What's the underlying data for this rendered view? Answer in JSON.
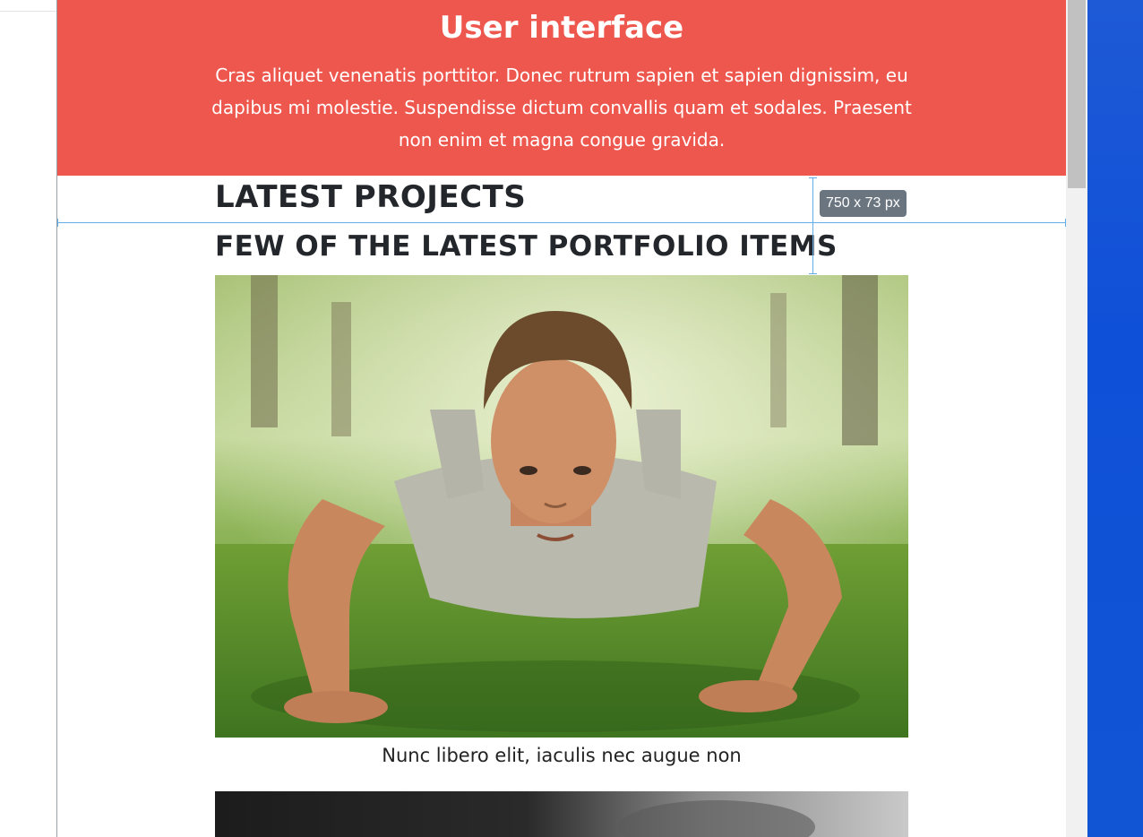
{
  "hero": {
    "title": "User interface",
    "paragraph": "Cras aliquet venenatis porttitor. Donec rutrum sapien et sapien dignissim, eu dapibus mi molestie. Suspendisse dictum convallis quam et sodales. Praesent non enim et magna congue gravida.",
    "background_color": "#ee574d"
  },
  "section": {
    "heading": "LATEST PROJECTS",
    "subheading": "FEW OF THE LATEST PORTFOLIO ITEMS"
  },
  "inspector": {
    "size_label": "750 x 73 px",
    "guide_color": "#63aee8"
  },
  "portfolio": {
    "items": [
      {
        "caption": "Nunc libero elit, iaculis nec augue non",
        "image": "man-doing-push-ups-on-grass"
      },
      {
        "image": "dark-blurred-photo"
      }
    ]
  },
  "colors": {
    "heading_text": "#23272b",
    "desktop": "#1155d4"
  }
}
